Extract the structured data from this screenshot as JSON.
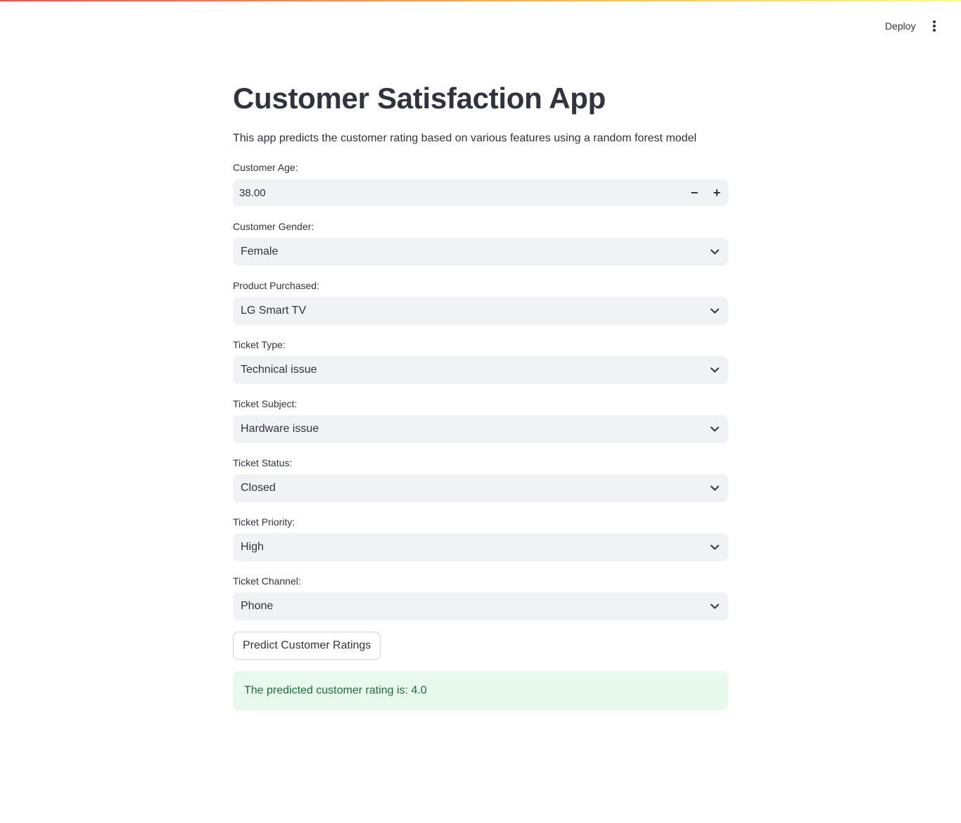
{
  "header": {
    "deploy_label": "Deploy",
    "menu_icon": "vertical-ellipsis-icon"
  },
  "colors": {
    "accent": "#ff4b4b",
    "field_bg": "#f0f2f6",
    "success_bg": "#e8f9ee",
    "success_text": "#177233",
    "text": "#31333f"
  },
  "page": {
    "title": "Customer Satisfaction App",
    "description": "This app predicts the customer rating based on various features using a random forest model"
  },
  "form": {
    "age": {
      "label": "Customer Age:",
      "value": "38.00",
      "minus": "−",
      "plus": "+"
    },
    "gender": {
      "label": "Customer Gender:",
      "value": "Female"
    },
    "product": {
      "label": "Product Purchased:",
      "value": "LG Smart TV"
    },
    "ticket_type": {
      "label": "Ticket Type:",
      "value": "Technical issue"
    },
    "ticket_subject": {
      "label": "Ticket Subject:",
      "value": "Hardware issue"
    },
    "ticket_status": {
      "label": "Ticket Status:",
      "value": "Closed"
    },
    "ticket_priority": {
      "label": "Ticket Priority:",
      "value": "High"
    },
    "ticket_channel": {
      "label": "Ticket Channel:",
      "value": "Phone"
    }
  },
  "predict_button_label": "Predict Customer Ratings",
  "result": {
    "message": "The predicted customer rating is: 4.0"
  }
}
